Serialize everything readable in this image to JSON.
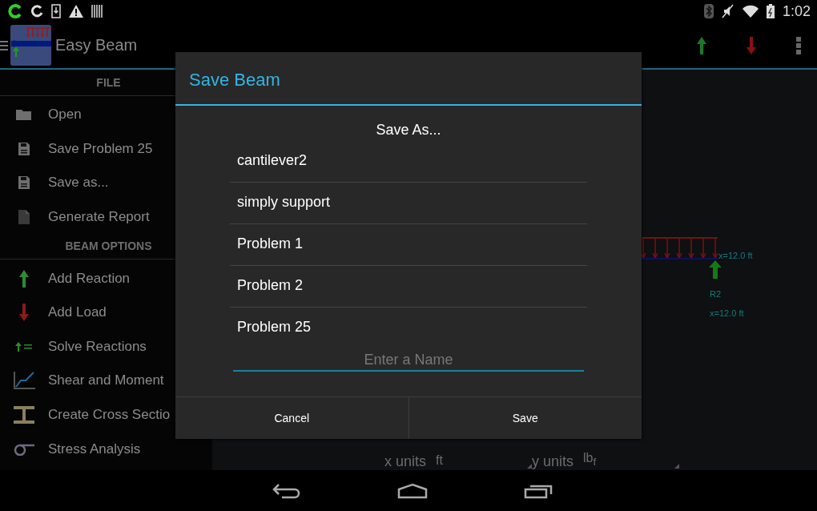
{
  "status_bar": {
    "time": "1:02"
  },
  "app_bar": {
    "title": "Easy Beam"
  },
  "drawer": {
    "sections": [
      {
        "header": "FILE",
        "items": [
          {
            "label": "Open"
          },
          {
            "label": "Save Problem 25"
          },
          {
            "label": "Save as..."
          },
          {
            "label": "Generate Report"
          }
        ]
      },
      {
        "header": "BEAM OPTIONS",
        "items": [
          {
            "label": "Add Reaction"
          },
          {
            "label": "Add Load"
          },
          {
            "label": "Solve Reactions"
          },
          {
            "label": "Shear and Moment"
          },
          {
            "label": "Create Cross Sectio"
          },
          {
            "label": "Stress Analysis"
          }
        ]
      }
    ]
  },
  "beam_view": {
    "load_position": "x=12.0 ft",
    "reaction_label": "R2",
    "reaction_position": "x=12.0 ft"
  },
  "units": [
    {
      "label": "x units",
      "value": "ft"
    },
    {
      "label": "y units",
      "value": "lb$_{f}$"
    }
  ],
  "dialog": {
    "title": "Save Beam",
    "heading": "Save As...",
    "files": [
      "cantilever2",
      "simply support",
      "Problem 1",
      "Problem 2",
      "Problem 25"
    ],
    "name_field": {
      "placeholder": "Enter a Name"
    },
    "buttons": [
      "Cancel",
      "Save"
    ]
  }
}
